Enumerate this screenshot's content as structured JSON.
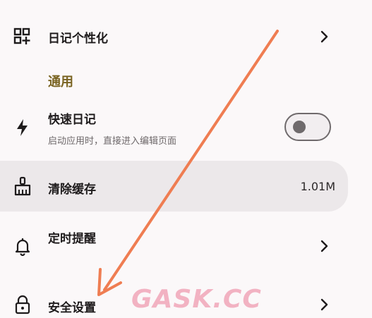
{
  "items": {
    "diary_personalize": {
      "label": "日记个性化",
      "icon": "grid-plus-icon"
    },
    "section_general": {
      "title": "通用"
    },
    "quick_diary": {
      "label": "快速日记",
      "description": "启动应用时，直接进入编辑页面",
      "icon": "lightning-icon",
      "toggle_on": false
    },
    "clear_cache": {
      "label": "清除缓存",
      "value": "1.01M",
      "icon": "broom-icon"
    },
    "reminder": {
      "label": "定时提醒",
      "icon": "bell-icon"
    },
    "security": {
      "label": "安全设置",
      "icon": "lock-icon"
    }
  },
  "annotation": {
    "arrow_color": "#ef7d52"
  },
  "watermark": {
    "text": "GASK.CC"
  },
  "colors": {
    "background": "#fbf8f9",
    "section_title": "#7a6422",
    "highlight": "#ece8ea"
  }
}
